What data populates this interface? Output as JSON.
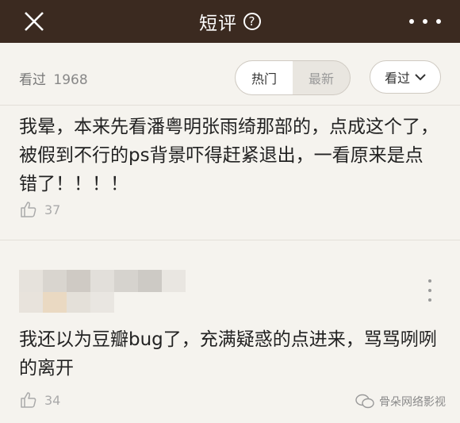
{
  "header": {
    "title": "短评",
    "help_icon": "?"
  },
  "filter": {
    "seen_label": "看过",
    "seen_count": "1968",
    "tab_hot": "热门",
    "tab_latest": "最新",
    "dropdown_label": "看过"
  },
  "comments": [
    {
      "text": "我晕，本来先看潘粤明张雨绮那部的，点成这个了，被假到不行的ps背景吓得赶紧退出，一看原来是点错了！！！！",
      "likes": "37"
    },
    {
      "text": "我还以为豆瓣bug了，充满疑惑的点进来，骂骂咧咧的离开",
      "likes": "34"
    }
  ],
  "watermark": "骨朵网络影视",
  "colors": {
    "header_bg": "#3b2a20",
    "page_bg": "#f5f3ee"
  }
}
